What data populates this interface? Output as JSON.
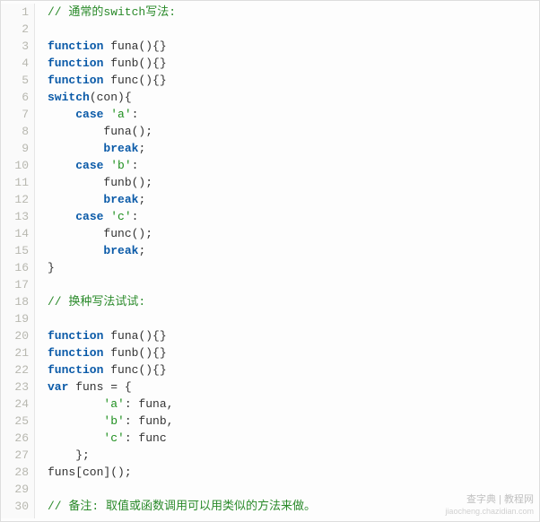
{
  "lines": [
    {
      "n": 1,
      "tokens": [
        [
          "cm",
          "// 通常的switch写法:"
        ]
      ]
    },
    {
      "n": 2,
      "tokens": []
    },
    {
      "n": 3,
      "tokens": [
        [
          "kw",
          "function"
        ],
        [
          "pn",
          " "
        ],
        [
          "id",
          "funa"
        ],
        [
          "pn",
          "(){}"
        ]
      ]
    },
    {
      "n": 4,
      "tokens": [
        [
          "kw",
          "function"
        ],
        [
          "pn",
          " "
        ],
        [
          "id",
          "funb"
        ],
        [
          "pn",
          "(){}"
        ]
      ]
    },
    {
      "n": 5,
      "tokens": [
        [
          "kw",
          "function"
        ],
        [
          "pn",
          " "
        ],
        [
          "id",
          "func"
        ],
        [
          "pn",
          "(){}"
        ]
      ]
    },
    {
      "n": 6,
      "tokens": [
        [
          "kw",
          "switch"
        ],
        [
          "pn",
          "(con){"
        ]
      ]
    },
    {
      "n": 7,
      "tokens": [
        [
          "pn",
          "    "
        ],
        [
          "kw",
          "case"
        ],
        [
          "pn",
          " "
        ],
        [
          "str",
          "'a'"
        ],
        [
          "pn",
          ":"
        ]
      ]
    },
    {
      "n": 8,
      "tokens": [
        [
          "pn",
          "        funa();"
        ]
      ]
    },
    {
      "n": 9,
      "tokens": [
        [
          "pn",
          "        "
        ],
        [
          "kw",
          "break"
        ],
        [
          "pn",
          ";"
        ]
      ]
    },
    {
      "n": 10,
      "tokens": [
        [
          "pn",
          "    "
        ],
        [
          "kw",
          "case"
        ],
        [
          "pn",
          " "
        ],
        [
          "str",
          "'b'"
        ],
        [
          "pn",
          ":"
        ]
      ]
    },
    {
      "n": 11,
      "tokens": [
        [
          "pn",
          "        funb();"
        ]
      ]
    },
    {
      "n": 12,
      "tokens": [
        [
          "pn",
          "        "
        ],
        [
          "kw",
          "break"
        ],
        [
          "pn",
          ";"
        ]
      ]
    },
    {
      "n": 13,
      "tokens": [
        [
          "pn",
          "    "
        ],
        [
          "kw",
          "case"
        ],
        [
          "pn",
          " "
        ],
        [
          "str",
          "'c'"
        ],
        [
          "pn",
          ":"
        ]
      ]
    },
    {
      "n": 14,
      "tokens": [
        [
          "pn",
          "        func();"
        ]
      ]
    },
    {
      "n": 15,
      "tokens": [
        [
          "pn",
          "        "
        ],
        [
          "kw",
          "break"
        ],
        [
          "pn",
          ";"
        ]
      ]
    },
    {
      "n": 16,
      "tokens": [
        [
          "pn",
          "}"
        ]
      ]
    },
    {
      "n": 17,
      "tokens": []
    },
    {
      "n": 18,
      "tokens": [
        [
          "cm",
          "// 换种写法试试:"
        ]
      ]
    },
    {
      "n": 19,
      "tokens": []
    },
    {
      "n": 20,
      "tokens": [
        [
          "kw",
          "function"
        ],
        [
          "pn",
          " "
        ],
        [
          "id",
          "funa"
        ],
        [
          "pn",
          "(){}"
        ]
      ]
    },
    {
      "n": 21,
      "tokens": [
        [
          "kw",
          "function"
        ],
        [
          "pn",
          " "
        ],
        [
          "id",
          "funb"
        ],
        [
          "pn",
          "(){}"
        ]
      ]
    },
    {
      "n": 22,
      "tokens": [
        [
          "kw",
          "function"
        ],
        [
          "pn",
          " "
        ],
        [
          "id",
          "func"
        ],
        [
          "pn",
          "(){}"
        ]
      ]
    },
    {
      "n": 23,
      "tokens": [
        [
          "kw",
          "var"
        ],
        [
          "pn",
          " funs = {"
        ]
      ]
    },
    {
      "n": 24,
      "tokens": [
        [
          "pn",
          "        "
        ],
        [
          "str",
          "'a'"
        ],
        [
          "pn",
          ": funa,"
        ]
      ]
    },
    {
      "n": 25,
      "tokens": [
        [
          "pn",
          "        "
        ],
        [
          "str",
          "'b'"
        ],
        [
          "pn",
          ": funb,"
        ]
      ]
    },
    {
      "n": 26,
      "tokens": [
        [
          "pn",
          "        "
        ],
        [
          "str",
          "'c'"
        ],
        [
          "pn",
          ": func"
        ]
      ]
    },
    {
      "n": 27,
      "tokens": [
        [
          "pn",
          "    };"
        ]
      ]
    },
    {
      "n": 28,
      "tokens": [
        [
          "pn",
          "funs[con]();"
        ]
      ]
    },
    {
      "n": 29,
      "tokens": []
    },
    {
      "n": 30,
      "tokens": [
        [
          "cm",
          "// 备注: 取值或函数调用可以用类似的方法来做。"
        ]
      ]
    }
  ],
  "watermark": {
    "line1": "查字典 | 教程网",
    "line2": "jiaocheng.chazidian.com"
  }
}
